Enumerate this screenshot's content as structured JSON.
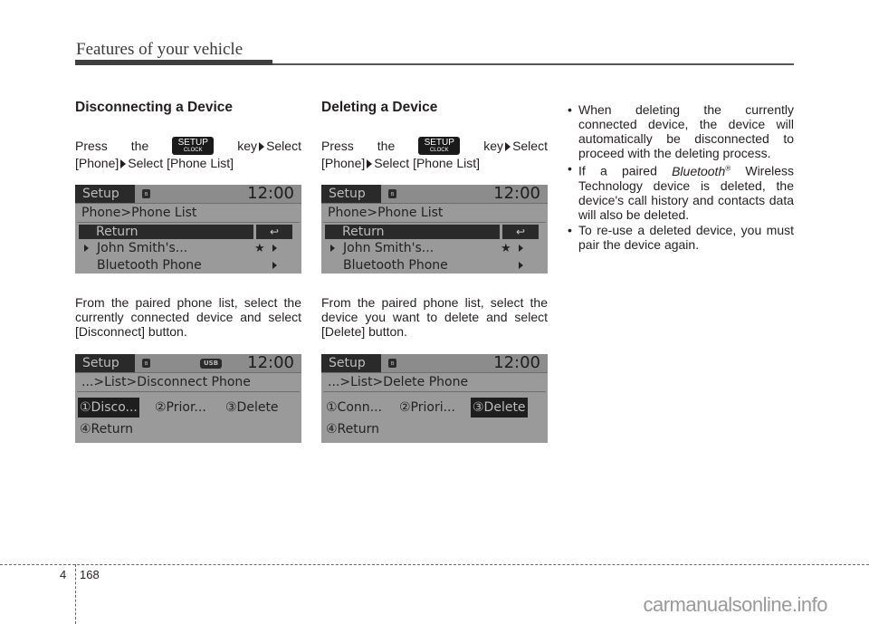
{
  "header": {
    "title": "Features of your vehicle"
  },
  "disconnect": {
    "heading": "Disconnecting a Device",
    "press_word": "Press",
    "the_word": "the",
    "key_label_top": "SETUP",
    "key_label_bottom": "CLOCK",
    "key_select": "key",
    "select_word": "Select",
    "line2_a": "[Phone]",
    "line2_b": "Select [Phone List]",
    "screen": {
      "tab": "Setup",
      "time": "12:00",
      "path": "Phone>Phone List",
      "return_label": "Return",
      "return_icon": "↩",
      "items": [
        {
          "name": "John Smith's...",
          "star": "★"
        },
        {
          "name": "Bluetooth Phone"
        }
      ]
    },
    "caption": "From the paired phone list, select the currently connected device and select [Disconnect] button.",
    "screen2": {
      "tab": "Setup",
      "usb": "USB",
      "time": "12:00",
      "path": "...>List>Disconnect Phone",
      "options": [
        "①Disco...",
        "②Prior...",
        "③Delete",
        "④Return"
      ],
      "selected_option": "①Disco..."
    }
  },
  "delete": {
    "heading": "Deleting a Device",
    "press_word": "Press",
    "the_word": "the",
    "key_label_top": "SETUP",
    "key_label_bottom": "CLOCK",
    "key_select": "key",
    "select_word": "Select",
    "line2_a": "[Phone]",
    "line2_b": "Select [Phone List]",
    "screen": {
      "tab": "Setup",
      "time": "12:00",
      "path": "Phone>Phone List",
      "return_label": "Return",
      "return_icon": "↩",
      "items": [
        {
          "name": "John Smith's...",
          "star": "★"
        },
        {
          "name": "Bluetooth Phone"
        }
      ]
    },
    "caption": "From the paired phone list, select the device you want to delete and select [Delete] button.",
    "screen2": {
      "tab": "Setup",
      "time": "12:00",
      "path": "...>List>Delete Phone",
      "options": [
        "①Conn...",
        "②Priori...",
        "③Delete",
        "④Return"
      ],
      "selected_option": "③Delete"
    }
  },
  "notes": {
    "bullet1": "When deleting the currently connected device, the device will automatically be disconnected to proceed with the deleting process.",
    "bullet2_pre": "If a paired",
    "bullet2_brand": "Bluetooth",
    "bullet2_reg": "®",
    "bullet2_post": "Wireless Technology device is deleted, the device's call history and contacts data will also be deleted.",
    "bullet3": "To re-use a deleted device, you must pair the device again."
  },
  "footer": {
    "chapter": "4",
    "page": "168",
    "watermark": "carmanualsonline.info"
  }
}
